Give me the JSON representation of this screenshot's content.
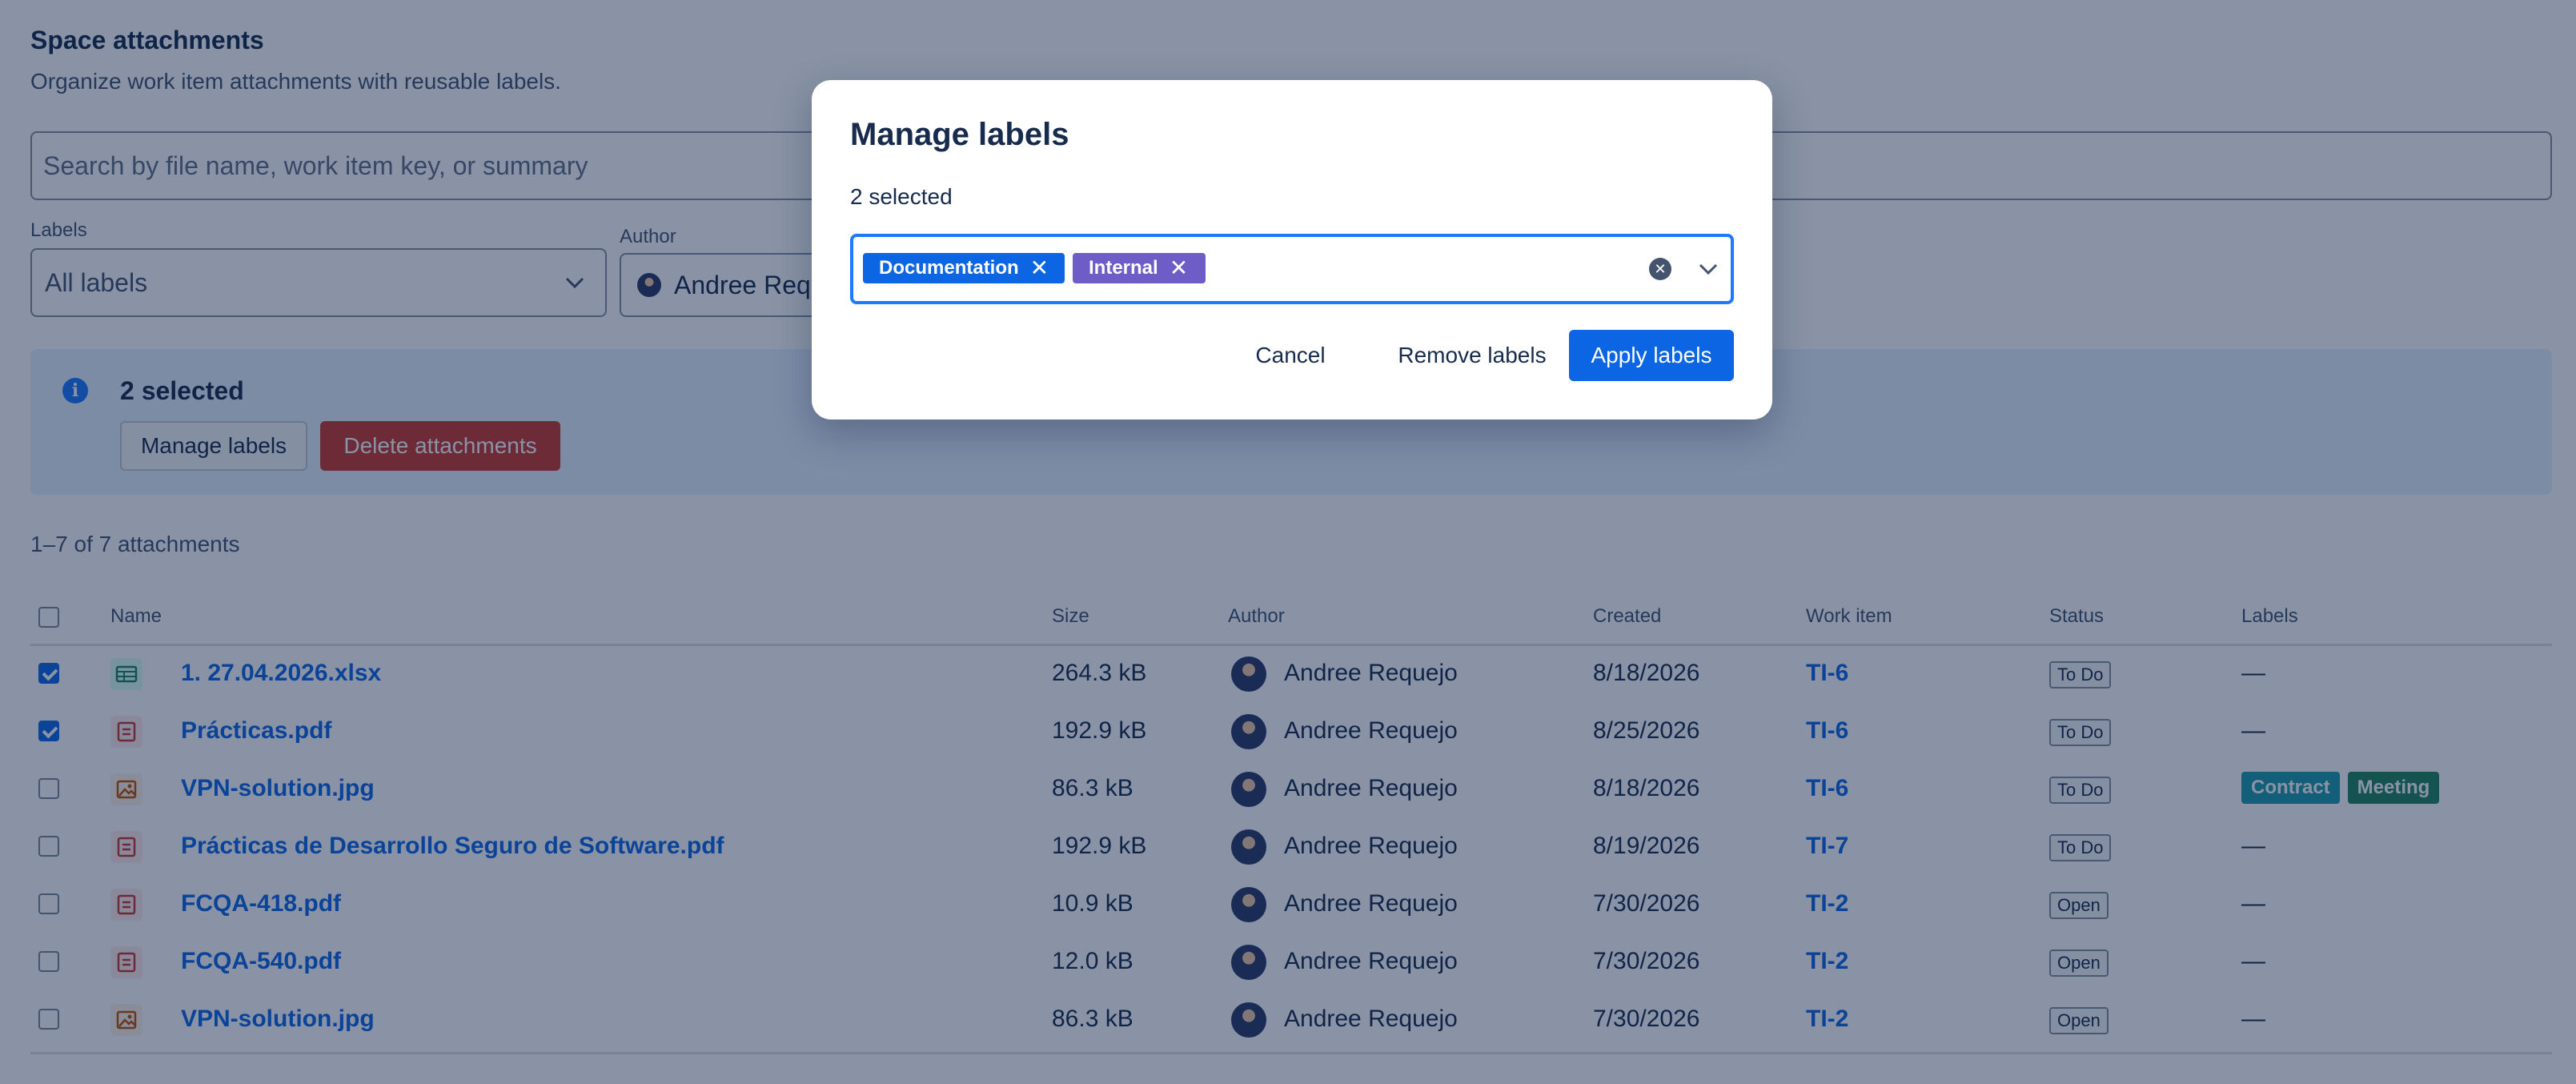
{
  "page": {
    "title": "Space attachments",
    "subtitle": "Organize work item attachments with reusable labels."
  },
  "search": {
    "placeholder": "Search by file name, work item key, or summary"
  },
  "filters": {
    "labels_label": "Labels",
    "labels_value": "All labels",
    "author_label": "Author",
    "author_value": "Andree Reque"
  },
  "banner": {
    "title": "2 selected",
    "manage_label": "Manage labels",
    "delete_label": "Delete attachments",
    "icon": "info-icon"
  },
  "count_text": "1–7 of 7 attachments",
  "table": {
    "headers": {
      "name": "Name",
      "size": "Size",
      "author": "Author",
      "created": "Created",
      "work_item": "Work item",
      "status": "Status",
      "labels": "Labels"
    },
    "rows": [
      {
        "checked": true,
        "type": "spreadsheet",
        "name": "1. 27.04.2026.xlsx",
        "size": "264.3 kB",
        "author": "Andree Requejo",
        "created": "8/18/2026",
        "work_item": "TI-6",
        "status": "To Do",
        "labels_text": "—"
      },
      {
        "checked": true,
        "type": "pdf",
        "name": "Prácticas.pdf",
        "size": "192.9 kB",
        "author": "Andree Requejo",
        "created": "8/25/2026",
        "work_item": "TI-6",
        "status": "To Do",
        "labels_text": "—"
      },
      {
        "checked": false,
        "type": "image",
        "name": "VPN-solution.jpg",
        "size": "86.3 kB",
        "author": "Andree Requejo",
        "created": "8/18/2026",
        "work_item": "TI-6",
        "status": "To Do",
        "labels_text": "",
        "labels": [
          "Contract",
          "Meeting"
        ]
      },
      {
        "checked": false,
        "type": "pdf",
        "name": "Prácticas de Desarrollo Seguro de Software.pdf",
        "size": "192.9 kB",
        "author": "Andree Requejo",
        "created": "8/19/2026",
        "work_item": "TI-7",
        "status": "To Do",
        "labels_text": "—"
      },
      {
        "checked": false,
        "type": "pdf",
        "name": "FCQA-418.pdf",
        "size": "10.9 kB",
        "author": "Andree Requejo",
        "created": "7/30/2026",
        "work_item": "TI-2",
        "status": "Open",
        "labels_text": "—"
      },
      {
        "checked": false,
        "type": "pdf",
        "name": "FCQA-540.pdf",
        "size": "12.0 kB",
        "author": "Andree Requejo",
        "created": "7/30/2026",
        "work_item": "TI-2",
        "status": "Open",
        "labels_text": "—"
      },
      {
        "checked": false,
        "type": "image",
        "name": "VPN-solution.jpg",
        "size": "86.3 kB",
        "author": "Andree Requejo",
        "created": "7/30/2026",
        "work_item": "TI-2",
        "status": "Open",
        "labels_text": "—"
      }
    ]
  },
  "label_colors": {
    "Contract": "#1d9aaa",
    "Meeting": "#1f845a",
    "Documentation": "#0c66e4",
    "Internal": "#6e5dc6"
  },
  "modal": {
    "title": "Manage labels",
    "subtitle": "2 selected",
    "selected_tags": [
      "Documentation",
      "Internal"
    ],
    "cancel_label": "Cancel",
    "remove_label": "Remove labels",
    "apply_label": "Apply labels"
  },
  "colors": {
    "accent": "#0c66e4",
    "danger": "#c9372c",
    "overlay": "#091e42"
  }
}
